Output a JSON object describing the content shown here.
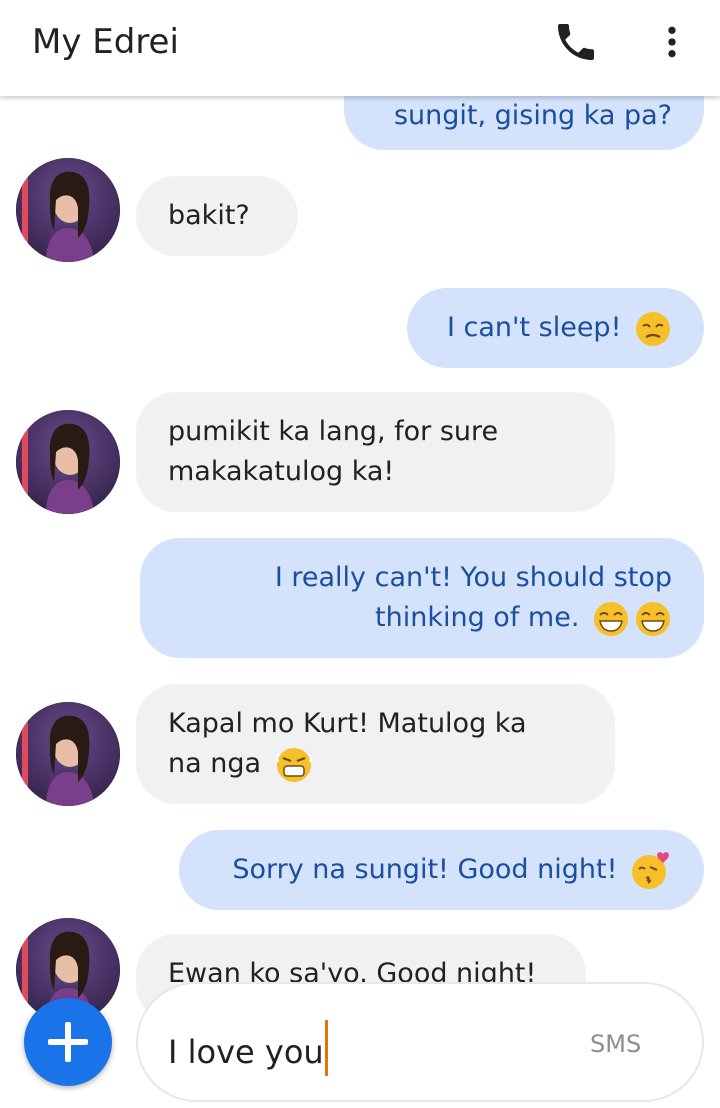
{
  "header": {
    "title": "My Edrei",
    "call_icon": "phone-icon",
    "menu_icon": "more-vert-icon"
  },
  "messages": [
    {
      "side": "out",
      "lines": [
        "sungit, gising ka pa?"
      ]
    },
    {
      "side": "in",
      "lines": [
        "bakit?"
      ]
    },
    {
      "side": "out",
      "lines": [
        "I can't sleep!"
      ],
      "emoji": "sleepy-face"
    },
    {
      "side": "in",
      "lines": [
        "pumikit ka lang, for sure",
        "makakatulog ka!"
      ]
    },
    {
      "side": "out",
      "lines": [
        "I really can't! You should stop",
        "thinking of me."
      ],
      "emoji": "grinning-face-x2"
    },
    {
      "side": "in",
      "lines": [
        "Kapal mo Kurt! Matulog ka",
        "na nga"
      ],
      "emoji": "angry-face"
    },
    {
      "side": "out",
      "lines": [
        "Sorry na sungit! Good night!"
      ],
      "emoji": "kissing-heart-face"
    },
    {
      "side": "in",
      "lines": [
        "Ewan ko sa'yo. Good night!"
      ]
    }
  ],
  "composer": {
    "add_icon": "plus-icon",
    "input_value": "I love you",
    "send_label": "SMS"
  },
  "colors": {
    "outgoing_bubble": "#d4e3fb",
    "outgoing_text": "#1a4fa0",
    "incoming_bubble": "#f0f1f3",
    "fab": "#1a73e8"
  }
}
